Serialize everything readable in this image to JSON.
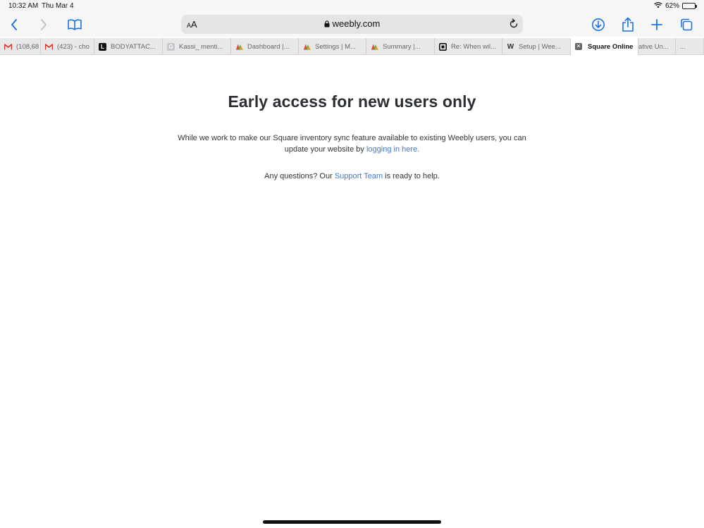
{
  "status_bar": {
    "time": "10:32 AM",
    "date": "Thu Mar 4",
    "battery_percent": "62%",
    "battery_level": 0.62
  },
  "toolbar": {
    "text_size_small": "A",
    "text_size_large": "A",
    "url": "weebly.com"
  },
  "tabs": [
    {
      "label": "(108,68",
      "favicon": "gmail"
    },
    {
      "label": "(423) - cho",
      "favicon": "gmail"
    },
    {
      "label": "BODYATTAC...",
      "favicon": "L"
    },
    {
      "label": "Kassi_ menti...",
      "favicon": "G"
    },
    {
      "label": "Dashboard |...",
      "favicon": "square-online"
    },
    {
      "label": "Settings | M...",
      "favicon": "square-online"
    },
    {
      "label": "Summary |...",
      "favicon": "square-online"
    },
    {
      "label": "Re: When wil...",
      "favicon": "square"
    },
    {
      "label": "Setup | Wee...",
      "favicon": "W"
    },
    {
      "label": "Square Online",
      "favicon": "close",
      "active": true
    },
    {
      "label": "ative Un...",
      "favicon": ""
    },
    {
      "label": "...",
      "favicon": ""
    }
  ],
  "main": {
    "headline": "Early access for new users only",
    "para_text_1": "While we work to make our Square inventory sync feature available to existing Weebly users, you can update your website by ",
    "login_link": "logging in here.",
    "questions_prefix": "Any questions? Our ",
    "support_link": "Support Team",
    "questions_suffix": " is ready to help."
  },
  "colors": {
    "link": "#3b7ad8",
    "toolbar_icon": "#1a73e8",
    "headline": "#2b2f33"
  }
}
